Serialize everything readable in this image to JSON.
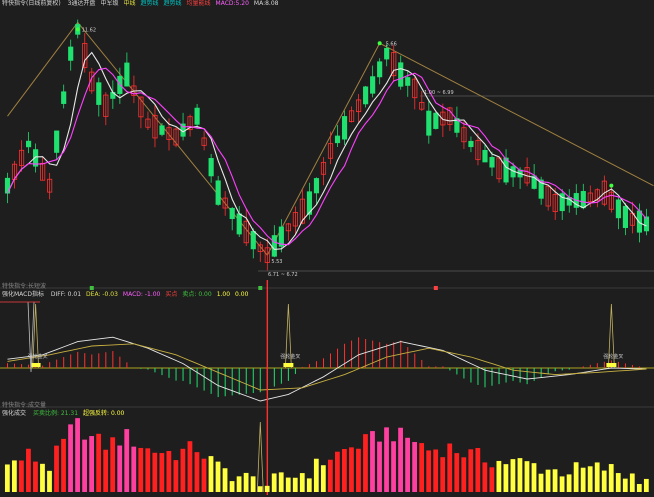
{
  "panels": {
    "main": {
      "title": "特快指令(日线前复权)",
      "items": [
        {
          "text": "3通达开盘",
          "color": "#d8d8d8"
        },
        {
          "text": "中军级",
          "color": "#d8d8d8"
        },
        {
          "text": "中线",
          "color": "#e0e040"
        },
        {
          "text": "趋势线",
          "color": "#00c8c8"
        },
        {
          "text": "趋势线",
          "color": "#00c8c8"
        },
        {
          "text": "均量能线",
          "color": "#ff4040"
        },
        {
          "text": "MACD:5.20",
          "color": "#ff60ff"
        },
        {
          "text": "MA:8.08",
          "color": "#d8d8d8"
        }
      ],
      "annotations": {
        "peak1": "11.62",
        "peak2_price": "5.66",
        "mid": "1.00 ~ 6.99",
        "low_range": "6.71 ~ 6.72",
        "low": "5.53"
      }
    },
    "macd": {
      "section_label": "特快指令:长短波",
      "title": "强化MACD指标",
      "items": [
        {
          "text": "DIFF: 0.01",
          "color": "#d8d8d8"
        },
        {
          "text": "DEA: -0.03",
          "color": "#e0e040"
        },
        {
          "text": "MACD: -1.00",
          "color": "#ff60ff"
        },
        {
          "text": "买点",
          "color": "#ff4040"
        },
        {
          "text": "卖点: 0.00",
          "color": "#40c040"
        },
        {
          "text": "1.00",
          "color": "#ffff40"
        },
        {
          "text": "0.00",
          "color": "#ffff40"
        }
      ],
      "signal_label": "强轮金叉"
    },
    "vol": {
      "section_label": "特快指令:成交量",
      "title": "强化成交",
      "items": [
        {
          "text": "买卖比例: 21.31",
          "color": "#40c040"
        },
        {
          "text": "超强反转: 0.00",
          "color": "#ffff40"
        }
      ]
    }
  },
  "colors": {
    "background": "#1e1e1e",
    "up": "#ff3030",
    "down": "#20e070",
    "ma_white": "#e8e8e8",
    "ma_magenta": "#ff40ff",
    "trend": "#a08040",
    "signal_yellow": "#ffff40"
  },
  "chart_data": {
    "type": "candlestick",
    "bars": 92,
    "trend_points": [
      [
        0,
        9.6
      ],
      [
        10,
        12.3
      ],
      [
        37,
        5.6
      ],
      [
        53,
        11.7
      ],
      [
        92,
        7.6
      ]
    ],
    "candle_path": [
      [
        0,
        7.6
      ],
      [
        3,
        8.8
      ],
      [
        6,
        7.6
      ],
      [
        9,
        11.4
      ],
      [
        10,
        12.1
      ],
      [
        12,
        10.6
      ],
      [
        14,
        9.9
      ],
      [
        17,
        10.8
      ],
      [
        20,
        9.4
      ],
      [
        24,
        9.0
      ],
      [
        27,
        9.6
      ],
      [
        30,
        7.4
      ],
      [
        33,
        6.5
      ],
      [
        36,
        5.8
      ],
      [
        37,
        5.6
      ],
      [
        40,
        6.4
      ],
      [
        43,
        7.1
      ],
      [
        46,
        8.6
      ],
      [
        49,
        9.6
      ],
      [
        52,
        10.5
      ],
      [
        54,
        11.4
      ],
      [
        56,
        10.8
      ],
      [
        58,
        10.4
      ],
      [
        60,
        9.4
      ],
      [
        63,
        9.6
      ],
      [
        66,
        8.8
      ],
      [
        70,
        8.1
      ],
      [
        74,
        7.9
      ],
      [
        78,
        7.1
      ],
      [
        82,
        7.2
      ],
      [
        85,
        7.4
      ],
      [
        88,
        6.7
      ],
      [
        91,
        6.5
      ]
    ],
    "macd_diff": [
      [
        0,
        0.4
      ],
      [
        5,
        0.6
      ],
      [
        10,
        1.2
      ],
      [
        15,
        1.4
      ],
      [
        20,
        0.9
      ],
      [
        25,
        0.2
      ],
      [
        30,
        -0.8
      ],
      [
        36,
        -1.5
      ],
      [
        40,
        -1.2
      ],
      [
        45,
        -0.4
      ],
      [
        50,
        0.6
      ],
      [
        56,
        1.2
      ],
      [
        62,
        0.8
      ],
      [
        68,
        -0.1
      ],
      [
        74,
        -0.5
      ],
      [
        80,
        -0.3
      ],
      [
        86,
        0.0
      ],
      [
        91,
        -0.05
      ]
    ],
    "macd_dea": [
      [
        0,
        0.3
      ],
      [
        6,
        0.6
      ],
      [
        12,
        1.0
      ],
      [
        18,
        1.1
      ],
      [
        24,
        0.6
      ],
      [
        30,
        -0.2
      ],
      [
        36,
        -1.0
      ],
      [
        42,
        -0.9
      ],
      [
        48,
        -0.3
      ],
      [
        54,
        0.5
      ],
      [
        60,
        0.9
      ],
      [
        66,
        0.5
      ],
      [
        72,
        -0.1
      ],
      [
        78,
        -0.3
      ],
      [
        84,
        -0.2
      ],
      [
        91,
        -0.05
      ]
    ],
    "macd_signals": [
      4,
      40,
      86
    ],
    "volume_signal": [
      36
    ],
    "ylim": [
      5.0,
      12.6
    ]
  }
}
